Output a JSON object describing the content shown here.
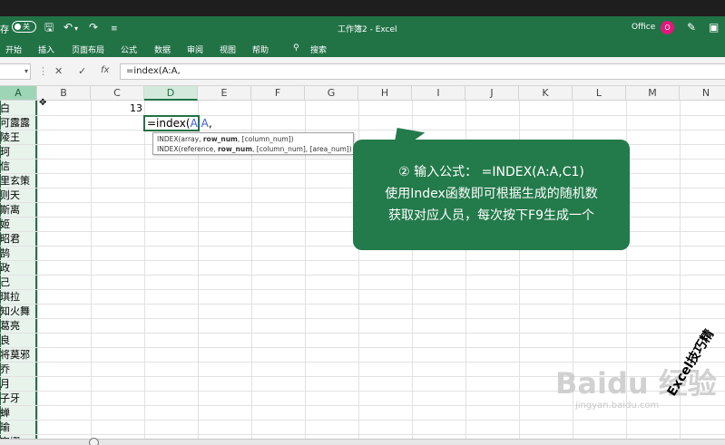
{
  "title_bar": {
    "autosave_label": "存",
    "toggle_text": "关",
    "title": "工作簿2 - Excel",
    "office_label": "Office",
    "avatar_letter": "O"
  },
  "ribbon": {
    "tabs": [
      "开始",
      "插入",
      "页面布局",
      "公式",
      "数据",
      "审阅",
      "视图",
      "帮助"
    ],
    "search_label": "搜索"
  },
  "formula_bar": {
    "cancel": "✕",
    "enter": "✓",
    "fx": "fx",
    "content": "=index(A:A,"
  },
  "columns": [
    "A",
    "B",
    "C",
    "D",
    "E",
    "F",
    "G",
    "H",
    "I",
    "J",
    "K",
    "L",
    "M",
    "N"
  ],
  "column_a_values": [
    "白",
    "可露露",
    "陵王",
    "珂",
    "信",
    "里玄策",
    "则天",
    "斯离",
    "姬",
    "昭君",
    "鹄",
    "政",
    "己",
    "琪拉",
    "知火舞",
    "葛亮",
    "良",
    "将莫邪",
    "乔",
    "月",
    "子牙",
    "蝉",
    "瑜",
    "安娜"
  ],
  "cells": {
    "C1": "13",
    "D2_prefix": "=index(",
    "D2_ref": "A:A",
    "D2_suffix": ","
  },
  "tooltip": {
    "line1_pre": "INDEX(array, ",
    "line1_bold": "row_num",
    "line1_post": ", [column_num])",
    "line2_pre": "INDEX(reference, ",
    "line2_bold": "row_num",
    "line2_post": ", [column_num], [area_num])"
  },
  "callout": {
    "line1": "② 输入公式： =INDEX(A:A,C1)",
    "line2": "使用Index函数即可根据生成的随机数",
    "line3": "获取对应人员，每次按下F9生成一个"
  },
  "watermark": {
    "main": "Baidu 经验",
    "sub": "jingyan.baidu.com",
    "brand": "Excel技巧精"
  },
  "colors": {
    "excel_green": "#217346",
    "callout_green": "#237a4b",
    "avatar_pink": "#e3167a"
  }
}
